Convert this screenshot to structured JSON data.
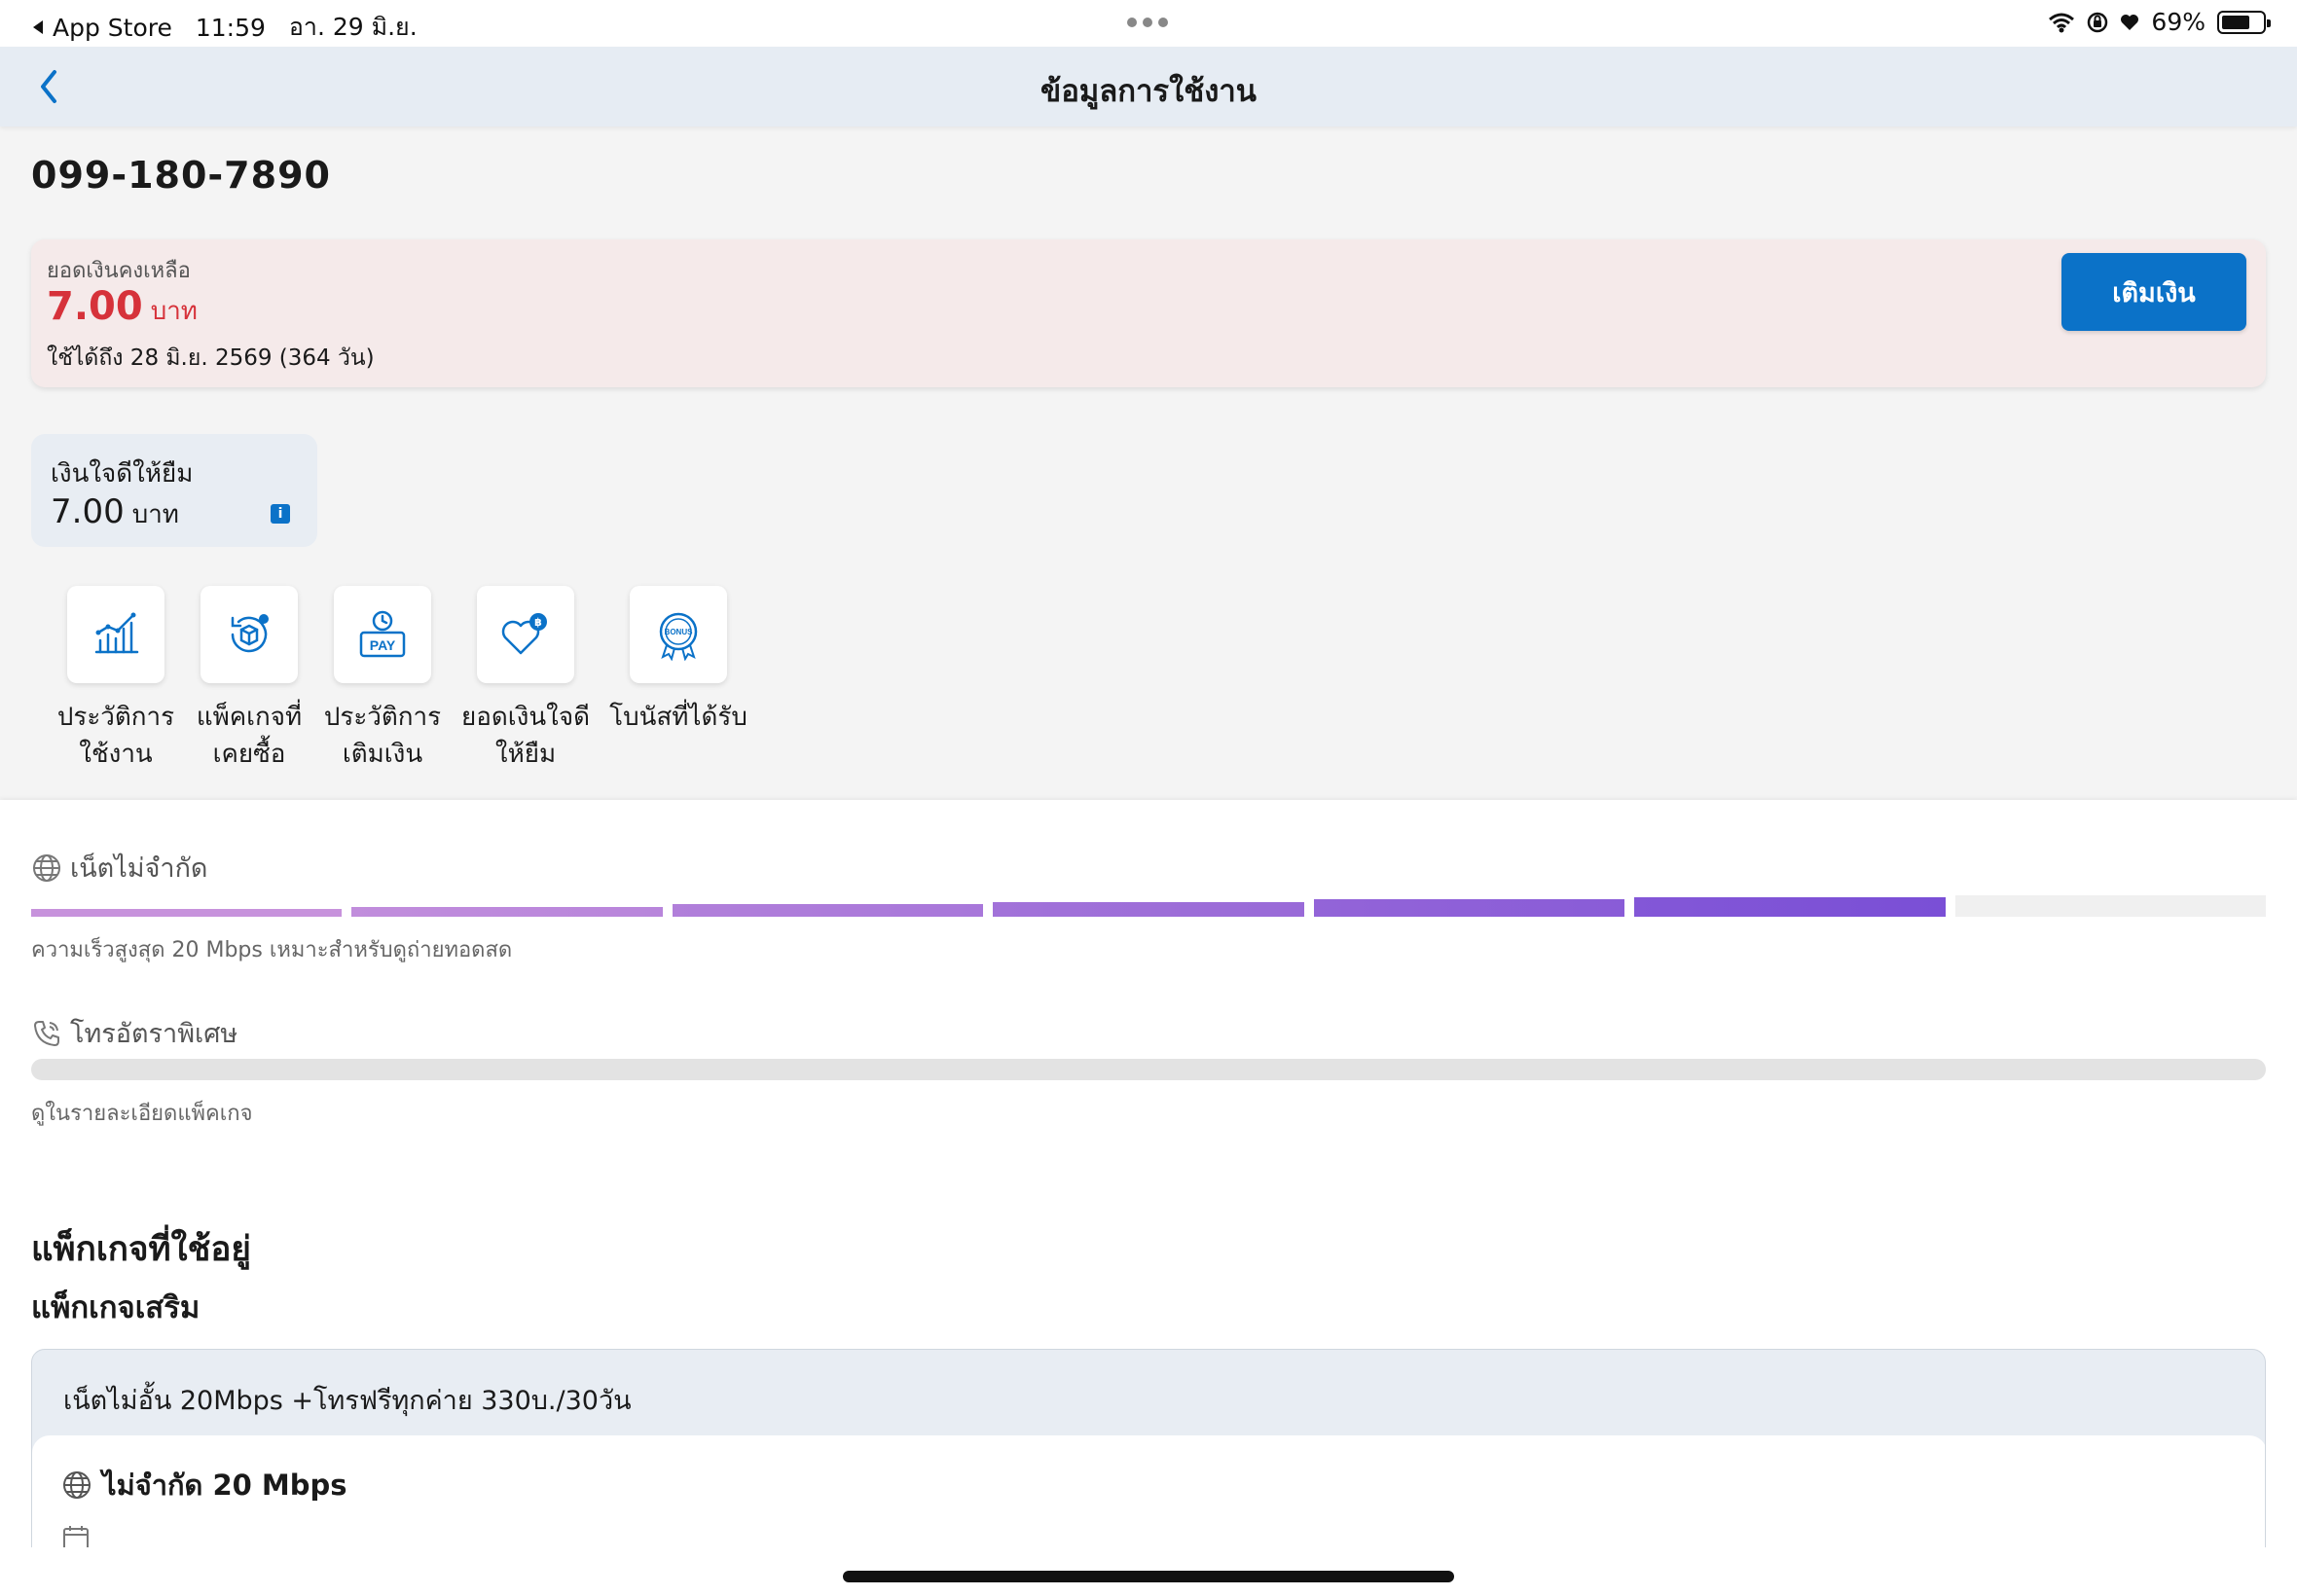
{
  "status_bar": {
    "back_app": "App Store",
    "time": "11:59",
    "date": "อา. 29 มิ.ย.",
    "battery": "69%",
    "battery_level": 0.69
  },
  "nav": {
    "title": "ข้อมูลการใช้งาน"
  },
  "phone_number": "099-180-7890",
  "balance": {
    "label": "ยอดเงินคงเหลือ",
    "amount": "7.00",
    "unit": "บาท",
    "valid_until": "ใช้ได้ถึง 28 มิ.ย. 2569 (364 วัน)",
    "topup_label": "เติมเงิน"
  },
  "loan": {
    "label": "เงินใจดีให้ยืม",
    "amount": "7.00",
    "unit": "บาท",
    "info_glyph": "i"
  },
  "shortcuts": [
    {
      "label": "ประวัติการ\nใช้งาน",
      "icon": "usage-chart-icon"
    },
    {
      "label": "แพ็คเกจที่\nเคยซื้อ",
      "icon": "package-history-icon"
    },
    {
      "label": "ประวัติการ\nเติมเงิน",
      "icon": "pay-history-icon"
    },
    {
      "label": "ยอดเงินใจดี\nให้ยืม",
      "icon": "heart-coin-icon"
    },
    {
      "label": "โบนัสที่ได้รับ",
      "icon": "bonus-badge-icon",
      "icon_text": "BONUS"
    }
  ],
  "internet": {
    "title": "เน็ตไม่จำกัด",
    "description": "ความเร็วสูงสุด 20 Mbps เหมาะสำหรับดูถ่ายทอดสด",
    "speed_level": 6,
    "speed_level_max": 7,
    "accent_start": "#c792dc",
    "accent_end": "#7a4fd6"
  },
  "call": {
    "title": "โทรอัตราพิเศษ",
    "description": "ดูในรายละเอียดแพ็คเกจ"
  },
  "packages": {
    "heading": "แพ็กเกจที่ใช้อยู่",
    "subheading": "แพ็กเกจเสริม",
    "item": {
      "name": "เน็ตไม่อั้น 20Mbps +โทรฟรีทุกค่าย 330บ./30วัน",
      "feature": "ไม่จำกัด 20 Mbps"
    }
  },
  "colors": {
    "primary": "#0b72c8",
    "balance_red": "#d6323a"
  }
}
